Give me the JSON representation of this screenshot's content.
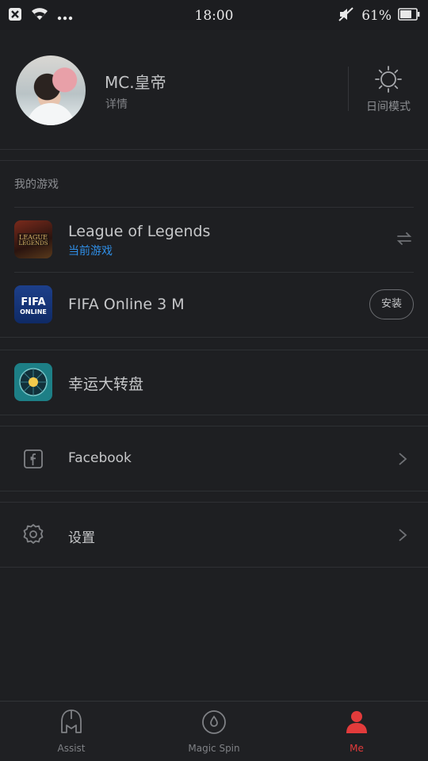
{
  "status_bar": {
    "time": "18:00",
    "battery_percent": "61%",
    "icons": [
      "close-notification-icon",
      "wifi-icon",
      "more-dots-icon",
      "mute-icon",
      "battery-icon"
    ]
  },
  "profile": {
    "username": "MC.皇帝",
    "detail_label": "详情",
    "day_mode_label": "日间模式"
  },
  "games_section": {
    "title": "我的游戏",
    "items": [
      {
        "name": "League of Legends",
        "subtitle": "当前游戏",
        "action_icon": "swap-icon"
      },
      {
        "name": "FIFA Online 3 M",
        "action_label": "安装"
      }
    ]
  },
  "lucky_wheel": {
    "label": "幸运大转盘"
  },
  "facebook": {
    "label": "Facebook"
  },
  "settings": {
    "label": "设置"
  },
  "bottom_nav": {
    "tabs": [
      {
        "label": "Assist",
        "active": false
      },
      {
        "label": "Magic Spin",
        "active": false
      },
      {
        "label": "Me",
        "active": true
      }
    ]
  },
  "colors": {
    "background": "#1e1f22",
    "accent_red": "#e23b3b",
    "link_blue": "#2f8ee6"
  }
}
